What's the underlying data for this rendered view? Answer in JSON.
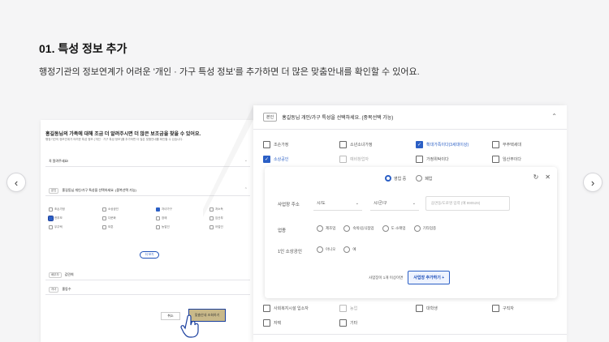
{
  "heading": "01. 특성 정보 추가",
  "subtitle": "행정기관의 정보연계가 어려운 '개인 · 가구 특성 정보'를 추가하면 더 많은 맞춤안내를 확인할 수 있어요.",
  "nav": {
    "prev": "‹",
    "next": "›"
  },
  "left_shot": {
    "title": "홍길동님의 가족에 대해 조금 더 알려주시면 더 많은 보조금을 찾을 수 있어요.",
    "desc": "행정기관의 정보연계가 어려운 특성 정보 ('개인 · 가구 특성 정보')를 추가하면 더 많은 맞춤안내를 확인할 수 있습니다.",
    "bars": [
      {
        "text": "꼭 알려주세요!"
      },
      {
        "tag": "본인",
        "text": "홍길동님 개인/가구 특성을 선택하세요. (중복선택 가능)"
      }
    ],
    "options": [
      "조손가정",
      "소상공인",
      "자녀가구",
      "저소득",
      "한부모",
      "다문화",
      "장애",
      "임산부",
      "무주택",
      "보훈",
      "농업인",
      "어업인"
    ],
    "more_label": "더 보기",
    "members": [
      {
        "tag": "배우자",
        "name": "김민희"
      },
      {
        "tag": "자녀",
        "name": "홍동수"
      }
    ],
    "cancel": "취소",
    "submit": "맞춤안내 조회하기"
  },
  "panel": {
    "tag": "본인",
    "title": "홍길동님 개인/가구 특성을 선택하세요. (중복선택 가능)",
    "top_options": [
      {
        "label": "조손가정",
        "checked": false,
        "dim": false
      },
      {
        "label": "소년소녀가정",
        "checked": false,
        "dim": false
      },
      {
        "label": "확대가족이다(3세대이상)",
        "checked": true,
        "dim": false
      },
      {
        "label": "무주택세대",
        "checked": false,
        "dim": false
      },
      {
        "label": "소상공인",
        "checked": true,
        "dim": false
      },
      {
        "label": "예비창업자",
        "checked": false,
        "dim": true
      },
      {
        "label": "가정위탁이다",
        "checked": false,
        "dim": false
      },
      {
        "label": "임산부이다",
        "checked": false,
        "dim": false
      }
    ],
    "status": {
      "options": [
        "영업 중",
        "폐업"
      ],
      "selected": "영업 중"
    },
    "address_label": "사업장 주소",
    "city_select": "시/도",
    "district_select": "시/군/구",
    "address_placeholder": "읍면동/도로명 입력 (예 990529)",
    "industry_label": "업종",
    "industry_options": [
      "제조업",
      "숙박/음식점업",
      "도·소매업",
      "기타업종"
    ],
    "solo_label": "1인 소상공인",
    "solo_options": [
      "아니오",
      "예"
    ],
    "add_note": "사업장이 1개 이상이면",
    "add_button": "사업장 추가하기 +",
    "bottom_options": [
      {
        "label": "사회복지시설 입소자",
        "checked": false,
        "dim": false
      },
      {
        "label": "농업",
        "checked": false,
        "dim": true
      },
      {
        "label": "대학생",
        "checked": false,
        "dim": false
      },
      {
        "label": "구직자",
        "checked": false,
        "dim": false
      },
      {
        "label": "자택",
        "checked": false,
        "dim": false
      },
      {
        "label": "기타",
        "checked": false,
        "dim": false
      }
    ]
  },
  "colors": {
    "accent": "#2b5fc5",
    "submit_bg": "#c9b98a",
    "page_bg": "#f5f5f6"
  }
}
